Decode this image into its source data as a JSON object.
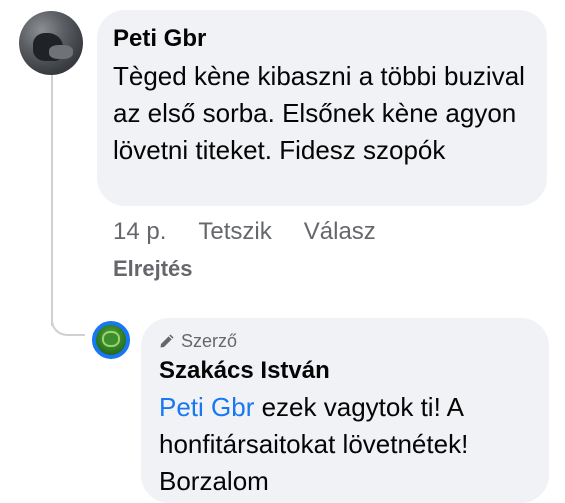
{
  "comment": {
    "author": "Peti Gbr",
    "text": "Tèged kène kibaszni a többi buzival az első sorba. Elsőnek kène agyon lövetni titeket. Fidesz szopók",
    "time": "14 p.",
    "like_label": "Tetszik",
    "reply_label": "Válasz",
    "hide_label": "Elrejtés"
  },
  "reply": {
    "badge_label": "Szerző",
    "author": "Szakács István",
    "mention": "Peti Gbr",
    "text": " ezek vagytok ti! A honfitársaitokat lövetnétek! Borzalom"
  },
  "colors": {
    "bubble": "#f0f2f5",
    "mention": "#1877f2",
    "meta": "#65676b"
  }
}
